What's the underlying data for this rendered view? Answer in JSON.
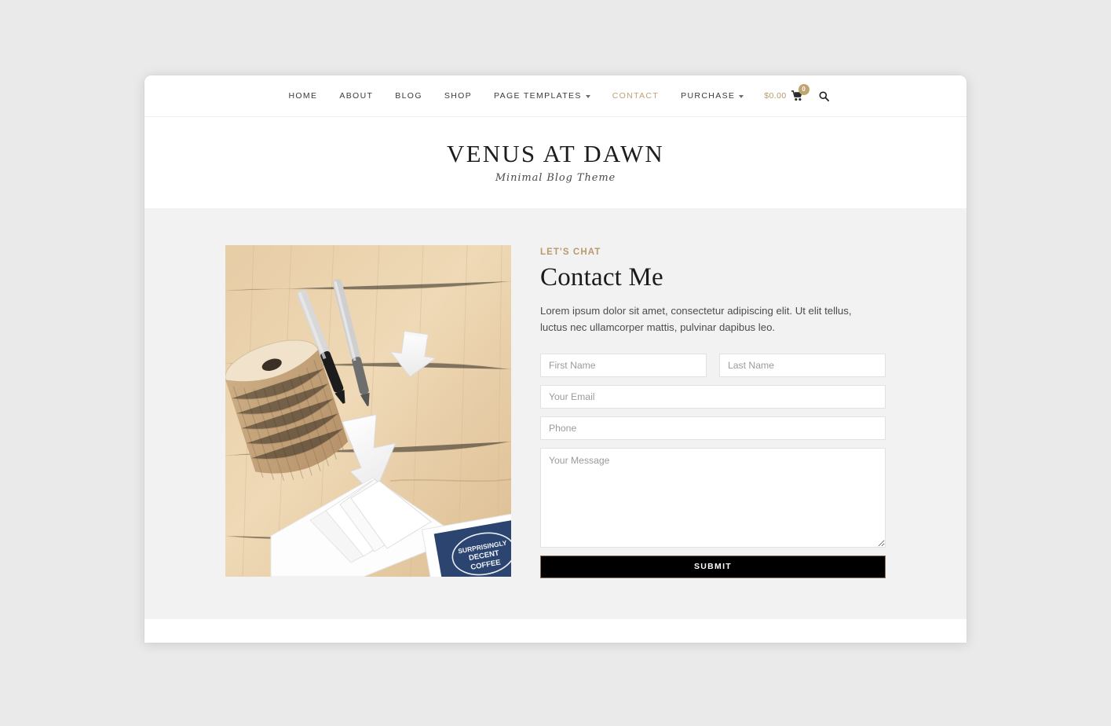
{
  "nav": {
    "items": [
      {
        "label": "HOME",
        "has_dropdown": false,
        "active": false
      },
      {
        "label": "ABOUT",
        "has_dropdown": false,
        "active": false
      },
      {
        "label": "BLOG",
        "has_dropdown": false,
        "active": false
      },
      {
        "label": "SHOP",
        "has_dropdown": false,
        "active": false
      },
      {
        "label": "PAGE TEMPLATES",
        "has_dropdown": true,
        "active": false
      },
      {
        "label": "CONTACT",
        "has_dropdown": false,
        "active": true
      },
      {
        "label": "PURCHASE",
        "has_dropdown": true,
        "active": false
      }
    ],
    "cart": {
      "amount": "$0.00",
      "count": "0",
      "icon": "shopping-cart-icon"
    },
    "search_icon": "search-icon",
    "active_color": "#c0a173",
    "badge_color": "#bfa472"
  },
  "brand": {
    "title": "VENUS AT DAWN",
    "tagline": "Minimal Blog Theme"
  },
  "contact": {
    "eyebrow": "LET'S CHAT",
    "heading": "Contact Me",
    "lead": "Lorem ipsum dolor sit amet, consectetur adipiscing elit. Ut elit tellus, luctus nec ullamcorper mattis, pulvinar dapibus leo.",
    "accent_color": "#b89a6d"
  },
  "photo": {
    "alt": "Wooden desk with pens, burlap ribbon spool, white paper arrows and envelopes",
    "card_text_1": "SURPRISINGLY",
    "card_text_2": "DECENT",
    "card_text_3": "COFFEE"
  },
  "form": {
    "first_name_placeholder": "First Name",
    "last_name_placeholder": "Last Name",
    "email_placeholder": "Your Email",
    "phone_placeholder": "Phone",
    "message_placeholder": "Your Message",
    "first_name_value": "",
    "last_name_value": "",
    "email_value": "",
    "phone_value": "",
    "message_value": "",
    "submit_label": "SUBMIT",
    "submit_bg": "#000000"
  },
  "theme": {
    "page_background": "#eaeaea",
    "section_background": "#f2f2f2",
    "window_background": "#ffffff"
  }
}
